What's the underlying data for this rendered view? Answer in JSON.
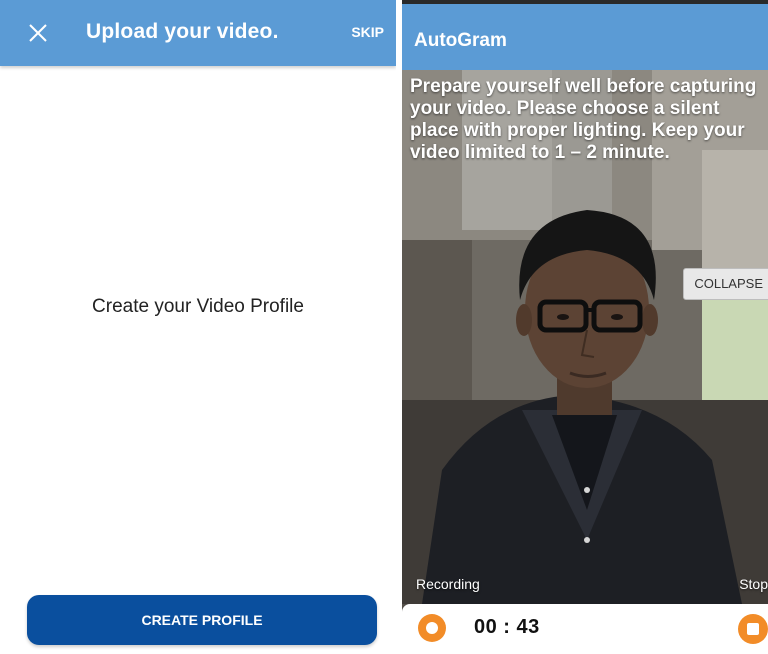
{
  "left_screen": {
    "header": {
      "close_icon": "close-icon",
      "title": "Upload your video.",
      "skip_label": "SKIP"
    },
    "heading": "Create your Video Profile",
    "create_button_label": "CREATE PROFILE"
  },
  "right_screen": {
    "header": {
      "title": "AutoGram"
    },
    "instructions": "Prepare yourself well before capturing your video. Please choose a silent place with proper lighting. Keep your video limited to 1 – 2 minute.",
    "collapse_label": "COLLAPSE",
    "recording_label": "Recording",
    "stop_label": "Stop",
    "timer": "00 : 43",
    "record_icon": "record-icon",
    "stop_icon": "stop-icon"
  },
  "colors": {
    "header_blue": "#5b9bd5",
    "button_dark_blue": "#0a4f9e",
    "accent_orange": "#f28c28"
  }
}
